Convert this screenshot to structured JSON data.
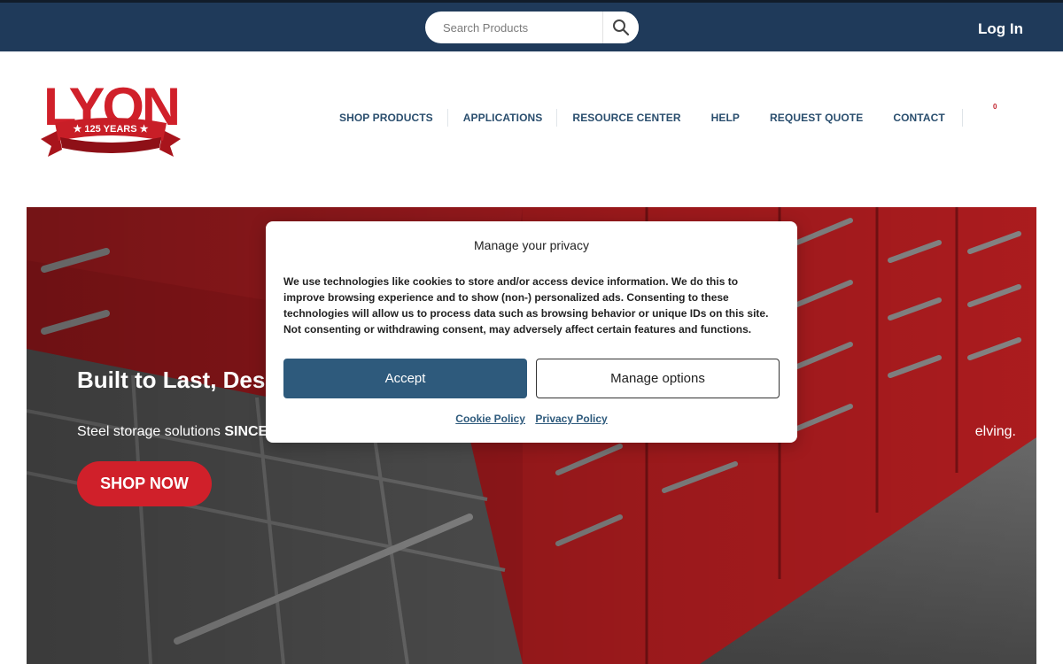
{
  "topbar": {
    "search": {
      "placeholder": "Search Products",
      "value": ""
    },
    "login_label": "Log In"
  },
  "logo": {
    "brand": "LYON",
    "tagline": "125 YEARS"
  },
  "nav": {
    "items": [
      {
        "label": "SHOP PRODUCTS"
      },
      {
        "label": "APPLICATIONS"
      },
      {
        "label": "RESOURCE CENTER"
      },
      {
        "label": "HELP"
      },
      {
        "label": "REQUEST QUOTE"
      },
      {
        "label": "CONTACT"
      }
    ],
    "cart_count": "0"
  },
  "hero": {
    "title": "Built to Last, Des",
    "subtitle_start": "Steel storage solutions ",
    "subtitle_bold": "SINCE",
    "subtitle_end": "elving.",
    "cta_label": "SHOP NOW"
  },
  "consent": {
    "title": "Manage your privacy",
    "body": "We use technologies like cookies to store and/or access device information. We do this to improve browsing experience and to show (non-) personalized ads. Consenting to these technologies will allow us to process data such as browsing behavior or unique IDs on this site. Not consenting or withdrawing consent, may adversely affect certain features and functions.",
    "accept_label": "Accept",
    "manage_label": "Manage options",
    "cookie_policy_label": "Cookie Policy",
    "privacy_policy_label": "Privacy Policy"
  },
  "colors": {
    "topbar": "#1f3a5a",
    "brand_red": "#d0202a",
    "nav_text": "#2a4e6e",
    "accept_button": "#2e5a7c"
  }
}
